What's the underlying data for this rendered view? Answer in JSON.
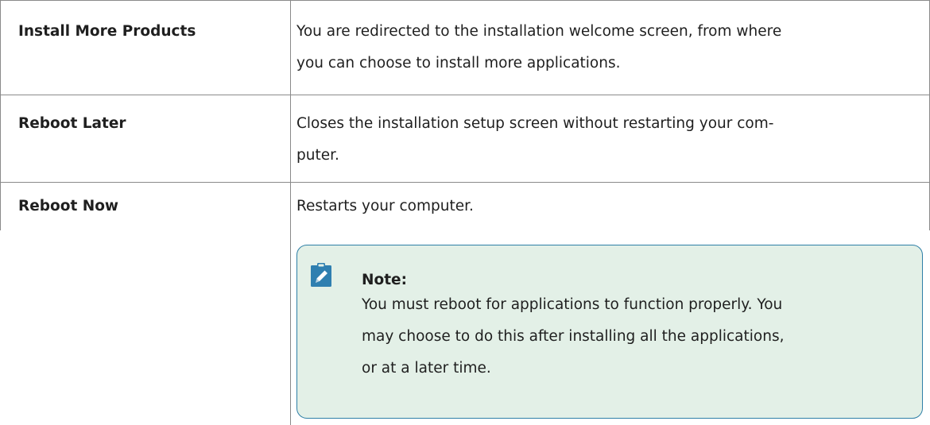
{
  "table": {
    "rows": [
      {
        "option": "Install More Products",
        "description_lines": [
          "You are redirected to the installation welcome screen, from where",
          "you can choose to install more applications."
        ]
      },
      {
        "option": "Reboot Later",
        "description_lines": [
          "Closes the installation setup screen without restarting your com-",
          "puter."
        ]
      },
      {
        "option": "Reboot Now",
        "description_lines": [
          "Restarts your computer."
        ]
      }
    ]
  },
  "note": {
    "icon": "pencil-note-icon",
    "title": "Note:",
    "body_lines": [
      "You must reboot for applications to function properly. You",
      "may choose to do this after installing all the applications,",
      "or at a later time."
    ]
  },
  "colors": {
    "note_border": "#2e7fa6",
    "note_background": "#e3f0e7",
    "icon_fill": "#2f7fb0",
    "table_rule": "#8a8a8a"
  }
}
